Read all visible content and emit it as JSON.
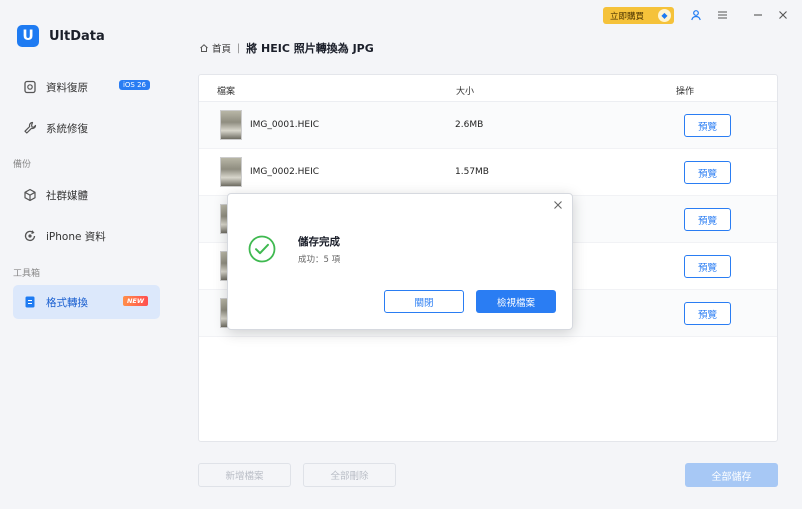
{
  "app": {
    "logo_letter": "U",
    "name": "UltData"
  },
  "sidebar": {
    "items": [
      {
        "label": "資料復原",
        "icon": "recovery-icon",
        "badge": "iOS 26"
      },
      {
        "label": "系統修復",
        "icon": "wrench-icon"
      },
      {
        "label": "社群媒體",
        "icon": "cube-icon"
      },
      {
        "label": "iPhone 資料",
        "icon": "refresh-icon"
      },
      {
        "label": "格式轉換",
        "icon": "convert-icon",
        "badge": "NEW"
      }
    ],
    "section_backup": "備份",
    "section_tools": "工具箱"
  },
  "titlebar": {
    "buy_label": "立即購買"
  },
  "breadcrumb": {
    "home": "首頁",
    "separator": "|",
    "title": "將 HEIC 照片轉換為 JPG"
  },
  "table": {
    "headers": {
      "file": "檔案",
      "size": "大小",
      "action": "操作"
    },
    "rows": [
      {
        "name": "IMG_0001.HEIC",
        "size": "2.6MB",
        "action": "預覽"
      },
      {
        "name": "IMG_0002.HEIC",
        "size": "1.57MB",
        "action": "預覽"
      },
      {
        "name": "",
        "size": "",
        "action": "預覽"
      },
      {
        "name": "",
        "size": "",
        "action": "預覽"
      },
      {
        "name": "",
        "size": "",
        "action": "預覽"
      }
    ]
  },
  "footer": {
    "add_label": "新增檔案",
    "delete_label": "全部刪除",
    "save_label": "全部儲存"
  },
  "dialog": {
    "title": "儲存完成",
    "subtitle": "成功：5 項",
    "close_label": "關閉",
    "view_label": "檢視檔案"
  },
  "colors": {
    "accent": "#2a7df3",
    "success": "#3fb950",
    "buy": "#f5c23a"
  }
}
